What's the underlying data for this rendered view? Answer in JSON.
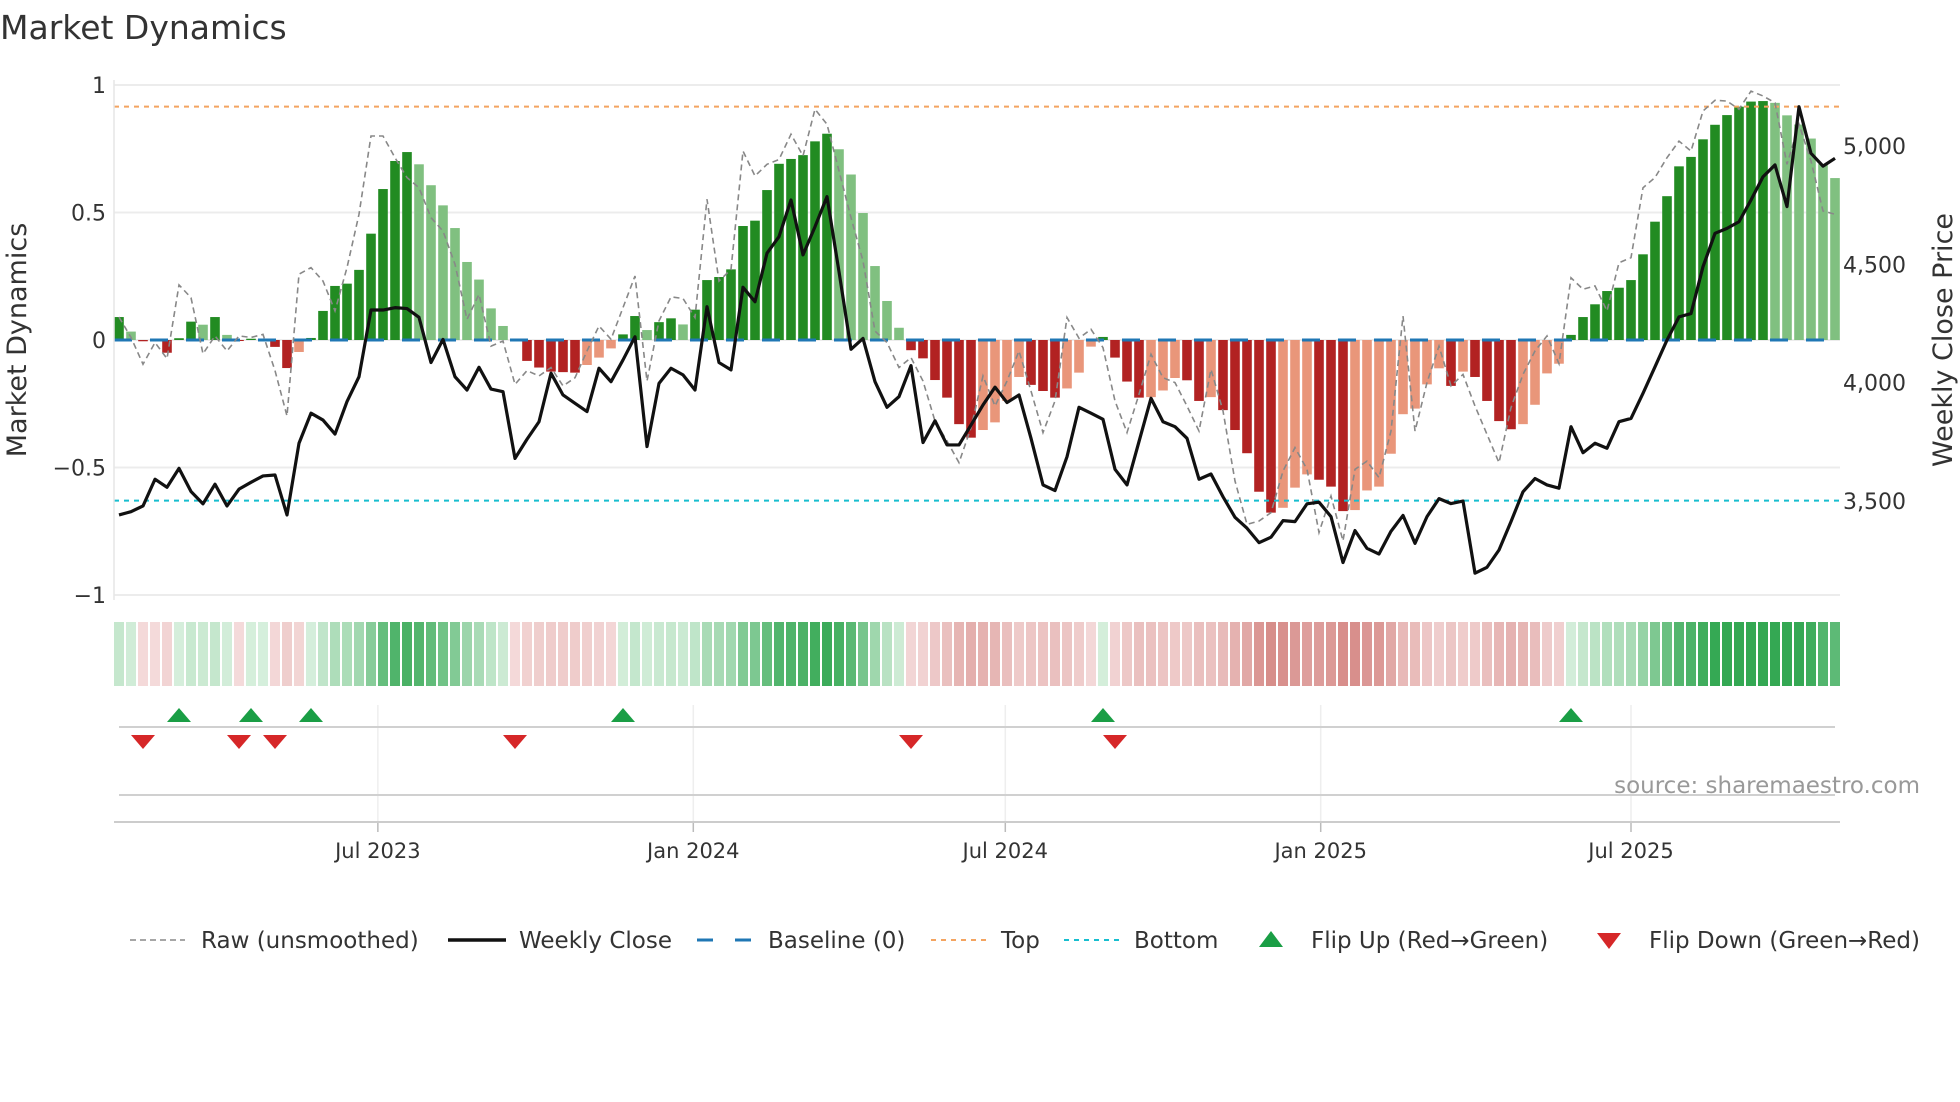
{
  "chart_data": {
    "type": "bar",
    "title": "Market Dynamics",
    "ylabel": "Market Dynamics",
    "y2label": "Weekly Close Price",
    "ylim": [
      -1,
      1
    ],
    "y2_ticks": [
      {
        "value": 5000,
        "label": "5,000"
      },
      {
        "value": 4500,
        "label": "4,500"
      },
      {
        "value": 4000,
        "label": "4,000"
      },
      {
        "value": 3500,
        "label": "3,500"
      }
    ],
    "y_ticks": [
      {
        "value": 1,
        "label": "1"
      },
      {
        "value": 0.5,
        "label": "0.5"
      },
      {
        "value": 0,
        "label": "0"
      },
      {
        "value": -0.5,
        "label": "−0.5"
      },
      {
        "value": -1,
        "label": "−1"
      }
    ],
    "start_date": "2023-01-31",
    "frequency": "weekly",
    "x_ticks": [
      {
        "date": "2023-07-01",
        "label": "Jul 2023"
      },
      {
        "date": "2024-01-01",
        "label": "Jan 2024"
      },
      {
        "date": "2024-07-01",
        "label": "Jul 2024"
      },
      {
        "date": "2025-01-01",
        "label": "Jan 2025"
      },
      {
        "date": "2025-07-01",
        "label": "Jul 2025"
      }
    ],
    "top_level": 0.915,
    "bottom_level": -0.63,
    "baseline": 0,
    "series": [
      {
        "name": "Market Dynamics (smoothed)",
        "values": [
          0.09,
          0.033,
          -0.005,
          -0.003,
          -0.05,
          0.007,
          0.072,
          0.06,
          0.09,
          0.02,
          -0.004,
          0.005,
          0.003,
          -0.027,
          -0.11,
          -0.047,
          0.008,
          0.114,
          0.212,
          0.221,
          0.275,
          0.417,
          0.592,
          0.702,
          0.737,
          0.689,
          0.607,
          0.528,
          0.439,
          0.306,
          0.237,
          0.124,
          0.055,
          -0.005,
          -0.082,
          -0.108,
          -0.124,
          -0.126,
          -0.128,
          -0.098,
          -0.069,
          -0.033,
          0.022,
          0.094,
          0.039,
          0.07,
          0.085,
          0.061,
          0.119,
          0.235,
          0.247,
          0.277,
          0.447,
          0.468,
          0.588,
          0.691,
          0.71,
          0.725,
          0.779,
          0.809,
          0.748,
          0.649,
          0.498,
          0.29,
          0.153,
          0.048,
          -0.04,
          -0.072,
          -0.157,
          -0.226,
          -0.33,
          -0.383,
          -0.353,
          -0.323,
          -0.239,
          -0.145,
          -0.176,
          -0.2,
          -0.226,
          -0.19,
          -0.128,
          -0.026,
          0.012,
          -0.069,
          -0.163,
          -0.226,
          -0.224,
          -0.198,
          -0.149,
          -0.158,
          -0.239,
          -0.224,
          -0.275,
          -0.353,
          -0.444,
          -0.595,
          -0.677,
          -0.658,
          -0.579,
          -0.527,
          -0.548,
          -0.575,
          -0.671,
          -0.667,
          -0.59,
          -0.575,
          -0.446,
          -0.291,
          -0.269,
          -0.174,
          -0.111,
          -0.18,
          -0.124,
          -0.145,
          -0.239,
          -0.318,
          -0.35,
          -0.33,
          -0.254,
          -0.131,
          -0.093,
          0.02,
          0.09,
          0.14,
          0.192,
          0.205,
          0.235,
          0.336,
          0.464,
          0.564,
          0.681,
          0.718,
          0.787,
          0.844,
          0.882,
          0.915,
          0.935,
          0.937,
          0.93,
          0.881,
          0.845,
          0.79,
          0.69,
          0.635
        ]
      },
      {
        "name": "Raw (unsmoothed)",
        "values": [
          0.09,
          0.01,
          -0.095,
          -0.01,
          -0.073,
          0.216,
          0.166,
          -0.054,
          0.016,
          -0.043,
          0.016,
          0.01,
          0.022,
          -0.12,
          -0.298,
          0.258,
          0.284,
          0.231,
          0.114,
          0.284,
          0.493,
          0.8,
          0.8,
          0.715,
          0.637,
          0.597,
          0.48,
          0.427,
          0.297,
          0.081,
          0.179,
          -0.024,
          -0.004,
          -0.174,
          -0.12,
          -0.141,
          -0.108,
          -0.18,
          -0.148,
          -0.043,
          0.055,
          0.003,
          0.127,
          0.251,
          -0.161,
          0.075,
          0.169,
          0.163,
          0.088,
          0.552,
          0.231,
          0.277,
          0.741,
          0.643,
          0.689,
          0.708,
          0.807,
          0.722,
          0.905,
          0.846,
          0.663,
          0.48,
          0.31,
          0.035,
          -0.01,
          -0.108,
          -0.069,
          -0.161,
          -0.318,
          -0.396,
          -0.481,
          -0.344,
          -0.141,
          -0.259,
          -0.161,
          -0.043,
          -0.2,
          -0.363,
          -0.239,
          0.088,
          0.007,
          0.042,
          -0.03,
          -0.239,
          -0.363,
          -0.213,
          -0.056,
          -0.148,
          -0.167,
          -0.259,
          -0.357,
          -0.115,
          -0.278,
          -0.553,
          -0.723,
          -0.71,
          -0.677,
          -0.514,
          -0.422,
          -0.507,
          -0.755,
          -0.612,
          -0.788,
          -0.507,
          -0.475,
          -0.54,
          -0.357,
          0.094,
          -0.357,
          -0.167,
          -0.024,
          -0.18,
          -0.135,
          -0.259,
          -0.37,
          -0.481,
          -0.265,
          -0.135,
          -0.043,
          0.016,
          -0.093,
          0.244,
          0.199,
          0.212,
          0.114,
          0.303,
          0.323,
          0.597,
          0.637,
          0.715,
          0.78,
          0.741,
          0.898,
          0.94,
          0.937,
          0.905,
          0.976,
          0.957,
          0.93,
          0.689,
          0.846,
          0.702,
          0.506,
          0.493
        ]
      },
      {
        "name": "Weekly Close",
        "values": [
          3441,
          3455,
          3479,
          3592,
          3558,
          3638,
          3540,
          3488,
          3571,
          3479,
          3550,
          3579,
          3606,
          3610,
          3441,
          3744,
          3871,
          3842,
          3783,
          3920,
          4025,
          4307,
          4307,
          4317,
          4313,
          4276,
          4085,
          4183,
          4025,
          3969,
          4065,
          3973,
          3962,
          3680,
          3761,
          3835,
          4040,
          3948,
          3913,
          3878,
          4061,
          4004,
          4096,
          4194,
          3730,
          3997,
          4061,
          4033,
          3969,
          4321,
          4085,
          4054,
          4403,
          4342,
          4547,
          4617,
          4772,
          4540,
          4659,
          4786,
          4469,
          4141,
          4187,
          4004,
          3896,
          3941,
          4072,
          3747,
          3839,
          3737,
          3737,
          3821,
          3906,
          3981,
          3916,
          3948,
          3765,
          3568,
          3544,
          3687,
          3896,
          3871,
          3845,
          3634,
          3568,
          3751,
          3934,
          3835,
          3814,
          3765,
          3592,
          3614,
          3518,
          3431,
          3385,
          3324,
          3347,
          3417,
          3413,
          3488,
          3495,
          3434,
          3240,
          3375,
          3300,
          3276,
          3372,
          3439,
          3321,
          3434,
          3510,
          3489,
          3500,
          3195,
          3220,
          3293,
          3413,
          3539,
          3595,
          3568,
          3554,
          3814,
          3704,
          3744,
          3723,
          3835,
          3849,
          3955,
          4067,
          4180,
          4278,
          4292,
          4490,
          4631,
          4652,
          4680,
          4772,
          4870,
          4920,
          4744,
          5166,
          4969,
          4915,
          4948
        ]
      }
    ],
    "flip_up_weeks": [
      5,
      11,
      16,
      42,
      82,
      121
    ],
    "flip_down_weeks": [
      2,
      10,
      13,
      33,
      66,
      83
    ],
    "legend": {
      "position": "bottom",
      "items": [
        {
          "label": "Raw (unsmoothed)",
          "style": "raw"
        },
        {
          "label": "Weekly Close",
          "style": "close"
        },
        {
          "label": "Baseline (0)",
          "style": "baseline"
        },
        {
          "label": "Top",
          "style": "top"
        },
        {
          "label": "Bottom",
          "style": "bottom"
        },
        {
          "label": "Flip Up (Red→Green)",
          "style": "up"
        },
        {
          "label": "Flip Down (Green→Red)",
          "style": "down"
        }
      ]
    },
    "source": "source: sharemaestro.com",
    "colors": {
      "green_rising": "#228b22",
      "green_falling": "#80c080",
      "red_falling": "#b22222",
      "red_rising": "#e9967a",
      "raw": "#888888",
      "close": "#111111",
      "baseline": "#1f77b4",
      "top": "#f4a460",
      "bottom": "#17becf",
      "flip_up": "#1a9e45",
      "flip_down": "#d62728",
      "heat_green_light": "#d6efdc",
      "heat_green_dark": "#34a853",
      "heat_red_light": "#f4dada",
      "heat_red_dark": "#d07a76"
    }
  }
}
